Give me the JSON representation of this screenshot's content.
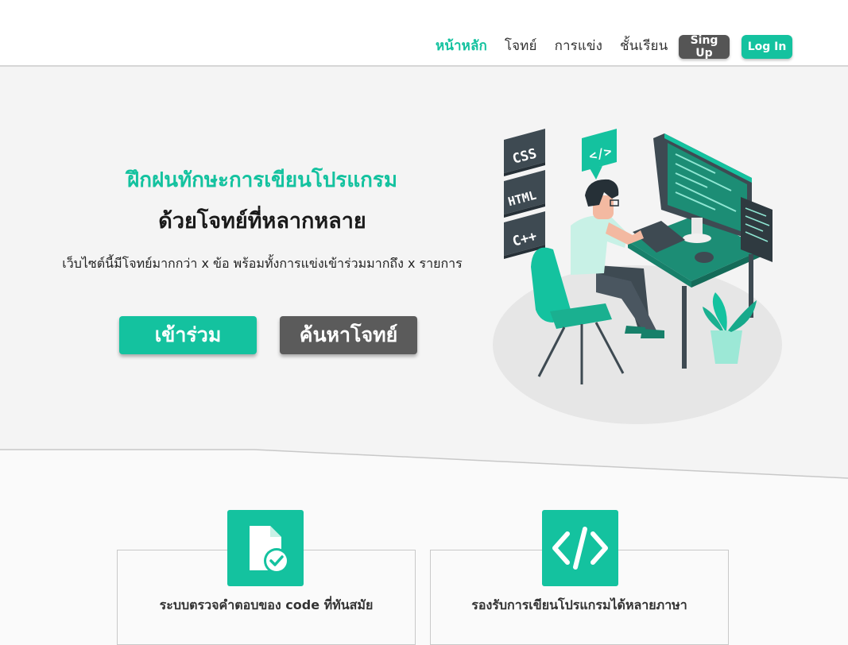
{
  "nav": {
    "links": [
      "หน้าหลัก",
      "โจทย์",
      "การแข่ง",
      "ชั้นเรียน"
    ],
    "signup_label": "Sing Up",
    "login_label": "Log In"
  },
  "hero": {
    "title_1": "ฝึกฝนทักษะการเขียนโปรแกรม",
    "title_2": "ด้วยโจทย์ที่หลากหลาย",
    "description": "เว็บไซต์นี้มีโจทย์มากกว่า x ข้อ พร้อมทั้งการแข่งเข้าร่วมมากถึง x รายการ",
    "join_label": "เข้าร่วม",
    "search_label": "ค้นหาโจทย์",
    "illustration_tags": [
      "CSS",
      "HTML",
      "C++",
      "</>"
    ]
  },
  "features": [
    {
      "label": "ระบบตรวจคำตอบของ code ที่ทันสมัย",
      "icon": "file-check-icon"
    },
    {
      "label": "รองรับการเขียนโปรแกรมได้หลายภาษา",
      "icon": "code-icon"
    }
  ],
  "colors": {
    "accent": "#14c29f",
    "dark_button": "#5b5b5b"
  }
}
